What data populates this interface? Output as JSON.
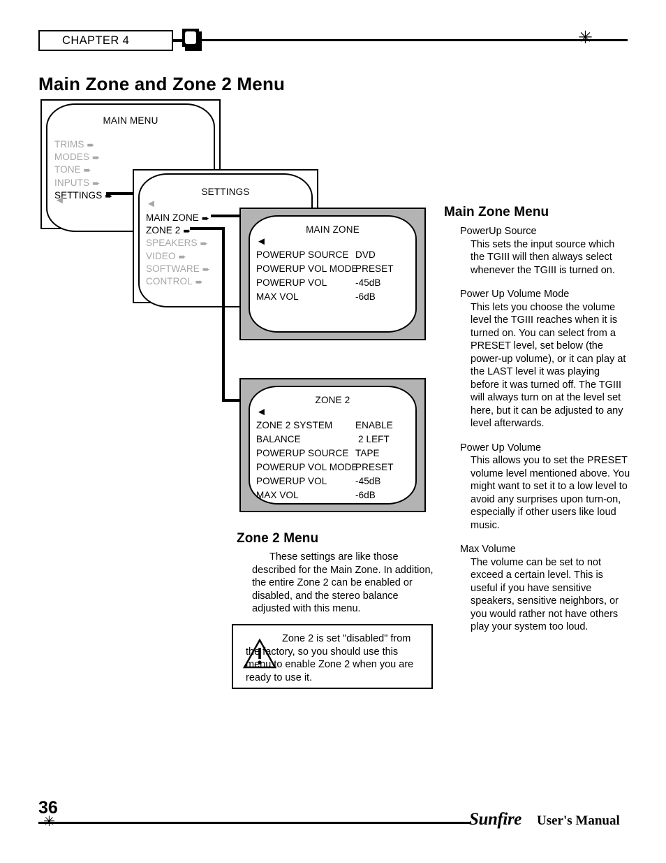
{
  "header": {
    "chapter": "CHAPTER 4",
    "tv_icon": "tv-monitor-icon",
    "star_icon": "✳"
  },
  "page_title": "Main Zone and Zone 2 Menu",
  "diagram": {
    "screens": [
      {
        "id": "main-menu",
        "title": "MAIN MENU",
        "items": [
          {
            "label": "TRIMS",
            "dim": true
          },
          {
            "label": "MODES",
            "dim": true
          },
          {
            "label": "TONE",
            "dim": true
          },
          {
            "label": "INPUTS",
            "dim": true
          },
          {
            "label": "SETTINGS",
            "dim": false
          }
        ]
      },
      {
        "id": "settings",
        "title": "SETTINGS",
        "items": [
          {
            "label": "MAIN ZONE",
            "dim": false
          },
          {
            "label": "ZONE 2",
            "dim": false
          },
          {
            "label": "SPEAKERS",
            "dim": true
          },
          {
            "label": "VIDEO",
            "dim": true
          },
          {
            "label": "SOFTWARE",
            "dim": true
          },
          {
            "label": "CONTROL",
            "dim": true
          }
        ]
      },
      {
        "id": "main-zone",
        "title": "MAIN ZONE",
        "rows": [
          {
            "key": "POWERUP SOURCE",
            "value": "DVD"
          },
          {
            "key": "POWERUP VOL MODE",
            "value": "PRESET"
          },
          {
            "key": "POWERUP VOL",
            "value": "-45dB"
          },
          {
            "key": "MAX VOL",
            "value": "-6dB"
          }
        ]
      },
      {
        "id": "zone-2",
        "title": "ZONE 2",
        "rows": [
          {
            "key": "ZONE 2 SYSTEM",
            "value": "ENABLE"
          },
          {
            "key": "BALANCE",
            "value": "2 LEFT"
          },
          {
            "key": "POWERUP SOURCE",
            "value": "TAPE"
          },
          {
            "key": "POWERUP VOL MODE",
            "value": "PRESET"
          },
          {
            "key": "POWERUP VOL",
            "value": "-45dB"
          },
          {
            "key": "MAX VOL",
            "value": "-6dB"
          }
        ]
      }
    ]
  },
  "main_zone_menu": {
    "heading": "Main Zone Menu",
    "entries": [
      {
        "term": "PowerUp Source",
        "text": "This sets the input source which the TGIII will then always select whenever the TGIII is turned on."
      },
      {
        "term": "Power Up Volume Mode",
        "text": "This lets you choose the volume level the TGIII reaches when it is turned on. You can select from a PRESET level, set below (the power-up volume), or it can play at the LAST level it was playing before it was turned off. The TGIII will always turn on at the level set here, but it can be adjusted to any level afterwards."
      },
      {
        "term": "Power Up Volume",
        "text": "This allows you to set the PRESET volume level mentioned above. You might want to set it to a low level to avoid any surprises upon turn-on, especially if other users like loud music."
      },
      {
        "term": "Max Volume",
        "text": "The volume can be set to not exceed a certain level. This is useful if you have sensitive speakers, sensitive neighbors, or you would rather not have others play your system too loud."
      }
    ]
  },
  "zone_2_menu": {
    "heading": "Zone 2 Menu",
    "text": "These settings are like those described for the Main Zone. In addition, the entire Zone 2 can be enabled or disabled, and the stereo balance adjusted with this menu."
  },
  "warning": {
    "icon": "warning-triangle-icon",
    "text": "Zone 2 is set \"disabled\" from the factory, so you should use this menu to enable Zone 2 when you are ready to use it."
  },
  "footer": {
    "page_number": "36",
    "star_icon": "✳",
    "brand": "Sunfire",
    "manual": "User's Manual"
  }
}
